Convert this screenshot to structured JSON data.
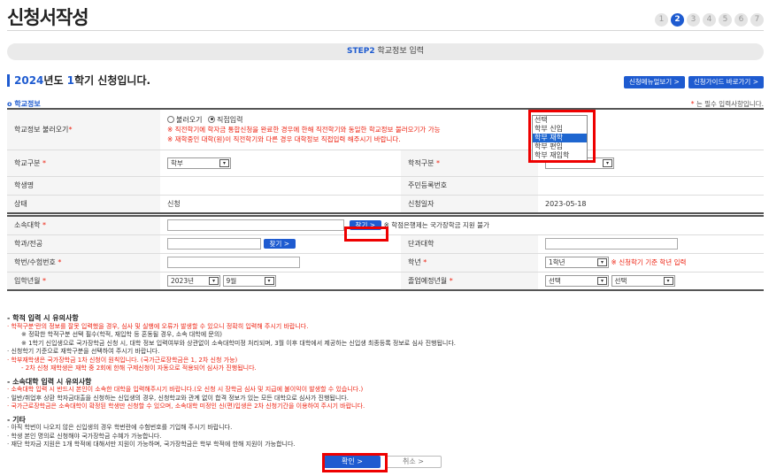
{
  "header": {
    "title": "신청서작성",
    "steps": [
      "1",
      "2",
      "3",
      "4",
      "5",
      "6",
      "7"
    ],
    "active_step": 2
  },
  "step_bar": {
    "step": "STEP2",
    "label": "학교정보 입력"
  },
  "semester": {
    "year": "2024",
    "year_suffix": "년도 ",
    "term": "1",
    "term_suffix": "학기 신청입니다."
  },
  "top_buttons": {
    "manual": "신청메뉴얼보기 >",
    "guide": "신청가이드 바로가기 >"
  },
  "section": {
    "title": "o 학교정보",
    "req_note_star": "*",
    "req_note": " 는 필수 입력사항입니다."
  },
  "form": {
    "school_load": {
      "label": "학교정보 불러오기",
      "radio_load": "불러오기",
      "radio_direct": "직접입력",
      "warn1": "※ 직전학기에 학자금 통합신청을 완료한 경우에 한해 직전학기와 동일한 학교정보 불러오기가 가능",
      "warn2": "※ 재학중인 대학(원)이 직전학기와 다른 경우 대학정보 직접입력 해주시기 바랍니다."
    },
    "school_type": {
      "label": "학교구분",
      "value": "학부"
    },
    "record_type": {
      "label": "학적구분"
    },
    "name": {
      "label": "학생명",
      "value": ""
    },
    "id_number": {
      "label": "주민등록번호",
      "value": ""
    },
    "status": {
      "label": "상태",
      "value": "신청"
    },
    "apply_date": {
      "label": "신청일자",
      "value": "2023-05-18"
    },
    "university": {
      "label": "소속대학",
      "find": "찾기 >",
      "note": "※ 학점은행제는 국가장학금 지원 불가"
    },
    "department": {
      "label": "학과/전공",
      "find": "찾기 >"
    },
    "college": {
      "label": "단과대학"
    },
    "student_no": {
      "label": "학번/수험번호"
    },
    "grade": {
      "label": "학년",
      "value": "1학년",
      "note": "※ 신청학기 기준 학년 입력"
    },
    "admission": {
      "label": "입학년월",
      "year": "2023년",
      "month": "9월"
    },
    "graduation": {
      "label": "졸업예정년월",
      "opt1": "선택",
      "opt2": "선택"
    },
    "star": "*"
  },
  "dropdown": {
    "options": [
      "선택",
      "학부 신입",
      "학부 재학",
      "학부 편입",
      "학부 재입학"
    ],
    "highlighted": 2
  },
  "notes": {
    "h1": "- 학적 입력 시 유의사항",
    "n1a": "· 학적구분'란의 정보를 잘못 입력했을 경우, 심사 및 실행에 오류가 발생할 수 있으니 정확히 입력해 주시기 바랍니다.",
    "n1b": "※ 정확한 학적구분 선택 필수(학적, 재입학 등 혼동될 경우, 소속 대학에 문의)",
    "n1c": "※ 1학기 신입생으로 국가장학금 신청 시, 대학 정보 입력여부와 상관없이 소속대학미정 처리되며, 3월 이후 대학에서 제공하는 신입생 최종등록 정보로 심사 진행됩니다.",
    "n1d": "· 신청학기 기준으로 재학구분을 선택하여 주시기 바랍니다.",
    "n1e": "· 학부재학생은 국가장학금 1차 신청이 원칙입니다. (국가근로장학금은 1, 2차 신청 가능)",
    "n1f": "- 2차 신청 재학생은 재학 중 2회에 한해 구제신청이 자동으로 적용되어 심사가 진행됩니다.",
    "h2": "- 소속대학 입력 시 유의사항",
    "n2a": "· 소속대학 입력 시 반드시 본인이 소속한 대학을 입력해주시기 바랍니다.(오 신청 시 장학금 심사 및 지급에 불이익이 발생할 수 있습니다.)",
    "n2b": "· 일반/취업후 상환 학자금대출을 신청하는 신입생의 경우, 신청학교와 관계 없이 합격 정보가 있는 모든 대학으로 심사가 진행됩니다.",
    "n2c": "· 국가근로장학금은 소속대학이 확정된 학생만 신청할 수 있으며, 소속대학 미정인 신(편)입생은 2차 신청기간을 이용하여 주시기 바랍니다.",
    "h3": "- 기타",
    "n3a": "· 아직 학번이 나오지 않은 신입생의 경우 학번란에 수험번호를 기입해 주시기 바랍니다.",
    "n3b": "· 학생 본인 명의로 신청해야 국가장학금 수혜가 가능합니다.",
    "n3c": "· 재단 학자금 지원은 1개 학적에 대해서만 지원이 가능하며, 국가장학금은 학부 학적에 한해 지원이 가능합니다."
  },
  "buttons": {
    "ok": "확인  >",
    "cancel": "취소  >"
  },
  "colors": {
    "primary": "#1e5bd0",
    "warning": "#e21111",
    "highlight_box": "#ee0000"
  }
}
